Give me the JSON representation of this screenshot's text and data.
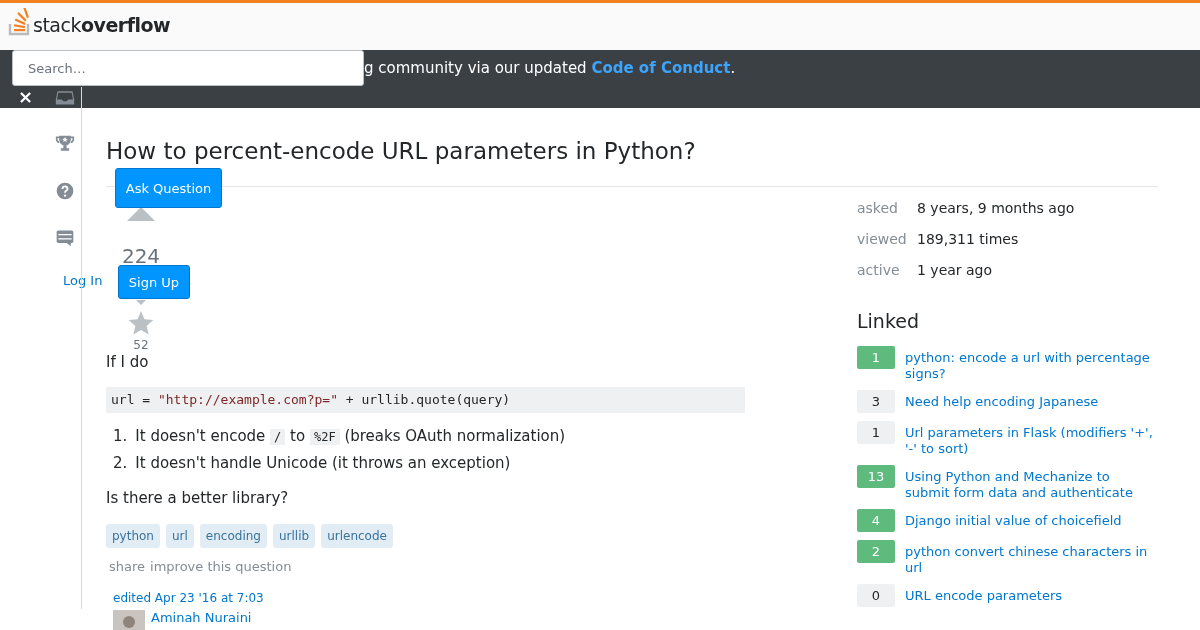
{
  "header": {
    "logo": "stack**overflow**",
    "search": {
      "placeholder": "Search…"
    }
  },
  "banner": {
    "text": "g community via our updated ",
    "link": "Code of Conduct",
    "end": ".",
    "close": "×"
  },
  "top_actions": {
    "ask": "Ask Question",
    "login": "Log In",
    "signup": "Sign Up"
  },
  "question": {
    "title": "How to percent-encode URL parameters in Python?",
    "votes": "224",
    "favorites": "52",
    "body": [
      {
        "kind": "paragraph",
        "text": "If I do"
      },
      {
        "kind": "code",
        "segments": [
          {
            "kind": "plain",
            "text": "url = "
          },
          {
            "kind": "string",
            "text": "\"http://example.com?p=\""
          },
          {
            "kind": "plain",
            "text": " + urllib.quote(query)"
          }
        ]
      },
      {
        "kind": "list",
        "items": [
          {
            "number": "1.",
            "segments": [
              {
                "kind": "text",
                "text": "It doesn't encode "
              },
              {
                "kind": "code",
                "text": "/"
              },
              {
                "kind": "text",
                "text": " to "
              },
              {
                "kind": "code",
                "text": "%2F"
              },
              {
                "kind": "text",
                "text": " (breaks OAuth normalization)"
              }
            ]
          },
          {
            "number": "2.",
            "segments": [
              {
                "kind": "text",
                "text": "It doesn't handle Unicode (it throws an exception)"
              }
            ]
          }
        ]
      },
      {
        "kind": "paragraph",
        "text": "Is there a better library?"
      }
    ],
    "tags": [
      "python",
      "url",
      "encoding",
      "urllib",
      "urlencode"
    ],
    "menu": [
      "share",
      "improve this question"
    ],
    "edited": "edited Apr 23 '16 at 7:03",
    "user": "Aminah Nuraini"
  },
  "stats": [
    {
      "label": "asked",
      "value": "8 years, 9 months ago"
    },
    {
      "label": "viewed",
      "value": "189,311 times"
    },
    {
      "label": "active",
      "value": "1 year ago"
    }
  ],
  "linked": {
    "title": "Linked",
    "items": [
      {
        "count": "1",
        "text": "python: encode a url with percentage signs?",
        "answered": true
      },
      {
        "count": "3",
        "text": "Need help encoding Japanese",
        "answered": false
      },
      {
        "count": "1",
        "text": "Url parameters in Flask (modifiers '+', '-' to sort)",
        "answered": false
      },
      {
        "count": "13",
        "text": "Using Python and Mechanize to submit form data and authenticate",
        "answered": true
      },
      {
        "count": "4",
        "text": "Django initial value of choicefield",
        "answered": true
      },
      {
        "count": "2",
        "text": "python convert chinese characters in url",
        "answered": true
      },
      {
        "count": "0",
        "text": "URL encode parameters",
        "answered": false
      }
    ]
  }
}
